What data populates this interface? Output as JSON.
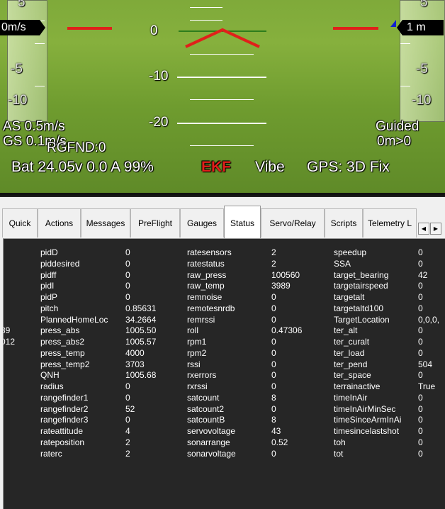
{
  "hud": {
    "speed_tape_box": "0m/s",
    "alt_tape_box": "1 m",
    "left_tape_nums": [
      "5",
      "-5",
      "-10"
    ],
    "right_tape_nums": [
      "5",
      "-5",
      "-10"
    ],
    "pitch_labels": [
      "0",
      "-10",
      "-20"
    ],
    "airspeed": "AS 0.5m/s",
    "groundspeed": "GS 0.1m/s",
    "rangefinder": "RGFND:0",
    "battery": "Bat 24.05v 0.0 A 99%",
    "ekf": "EKF",
    "vibe": "Vibe",
    "gps": "GPS: 3D Fix",
    "mode": "Guided",
    "wp_distance": "0m>0",
    "colors": {
      "ekf": "#e0201a",
      "horizon_line": "#2e7d1c",
      "marker_red": "#e0201a",
      "ground": "#7faa3a"
    }
  },
  "tabs": [
    {
      "label": "Quick"
    },
    {
      "label": "Actions"
    },
    {
      "label": "Messages"
    },
    {
      "label": "PreFlight"
    },
    {
      "label": "Gauges"
    },
    {
      "label": "Status",
      "active": true
    },
    {
      "label": "Servo/Relay"
    },
    {
      "label": "Scripts"
    },
    {
      "label": "Telemetry L"
    }
  ],
  "status": {
    "left_partial_values": [
      "39",
      "012"
    ],
    "col1": [
      [
        "pidD",
        "0"
      ],
      [
        "piddesired",
        "0"
      ],
      [
        "pidff",
        "0"
      ],
      [
        "pidI",
        "0"
      ],
      [
        "pidP",
        "0"
      ],
      [
        "pitch",
        "0.85631"
      ],
      [
        "PlannedHomeLoc",
        "34.2664"
      ],
      [
        "press_abs",
        "1005.50"
      ],
      [
        "press_abs2",
        "1005.57"
      ],
      [
        "press_temp",
        "4000"
      ],
      [
        "press_temp2",
        "3703"
      ],
      [
        "QNH",
        "1005.68"
      ],
      [
        "radius",
        "0"
      ],
      [
        "rangefinder1",
        "0"
      ],
      [
        "rangefinder2",
        "52"
      ],
      [
        "rangefinder3",
        "0"
      ],
      [
        "rateattitude",
        "4"
      ],
      [
        "rateposition",
        "2"
      ],
      [
        "raterc",
        "2"
      ]
    ],
    "col2": [
      [
        "ratesensors",
        "2"
      ],
      [
        "ratestatus",
        "2"
      ],
      [
        "raw_press",
        "100560"
      ],
      [
        "raw_temp",
        "3989"
      ],
      [
        "remnoise",
        "0"
      ],
      [
        "remotesnrdb",
        "0"
      ],
      [
        "remrssi",
        "0"
      ],
      [
        "roll",
        "0.47306"
      ],
      [
        "rpm1",
        "0"
      ],
      [
        "rpm2",
        "0"
      ],
      [
        "rssi",
        "0"
      ],
      [
        "rxerrors",
        "0"
      ],
      [
        "rxrssi",
        "0"
      ],
      [
        "satcount",
        "8"
      ],
      [
        "satcount2",
        "0"
      ],
      [
        "satcountB",
        "8"
      ],
      [
        "servovoltage",
        "43"
      ],
      [
        "sonarrange",
        "0.52"
      ],
      [
        "sonarvoltage",
        "0"
      ]
    ],
    "col3": [
      [
        "speedup",
        "0"
      ],
      [
        "SSA",
        "0"
      ],
      [
        "target_bearing",
        "42"
      ],
      [
        "targetairspeed",
        "0"
      ],
      [
        "targetalt",
        "0"
      ],
      [
        "targetaltd100",
        "0"
      ],
      [
        "TargetLocation",
        "0,0,0,"
      ],
      [
        "ter_alt",
        "0"
      ],
      [
        "ter_curalt",
        "0"
      ],
      [
        "ter_load",
        "0"
      ],
      [
        "ter_pend",
        "504"
      ],
      [
        "ter_space",
        "0"
      ],
      [
        "terrainactive",
        "True"
      ],
      [
        "timeInAir",
        "0"
      ],
      [
        "timeInAirMinSec",
        "0"
      ],
      [
        "timeSinceArmInAi",
        "0"
      ],
      [
        "timesincelastshot",
        "0"
      ],
      [
        "toh",
        "0"
      ],
      [
        "tot",
        "0"
      ]
    ]
  }
}
